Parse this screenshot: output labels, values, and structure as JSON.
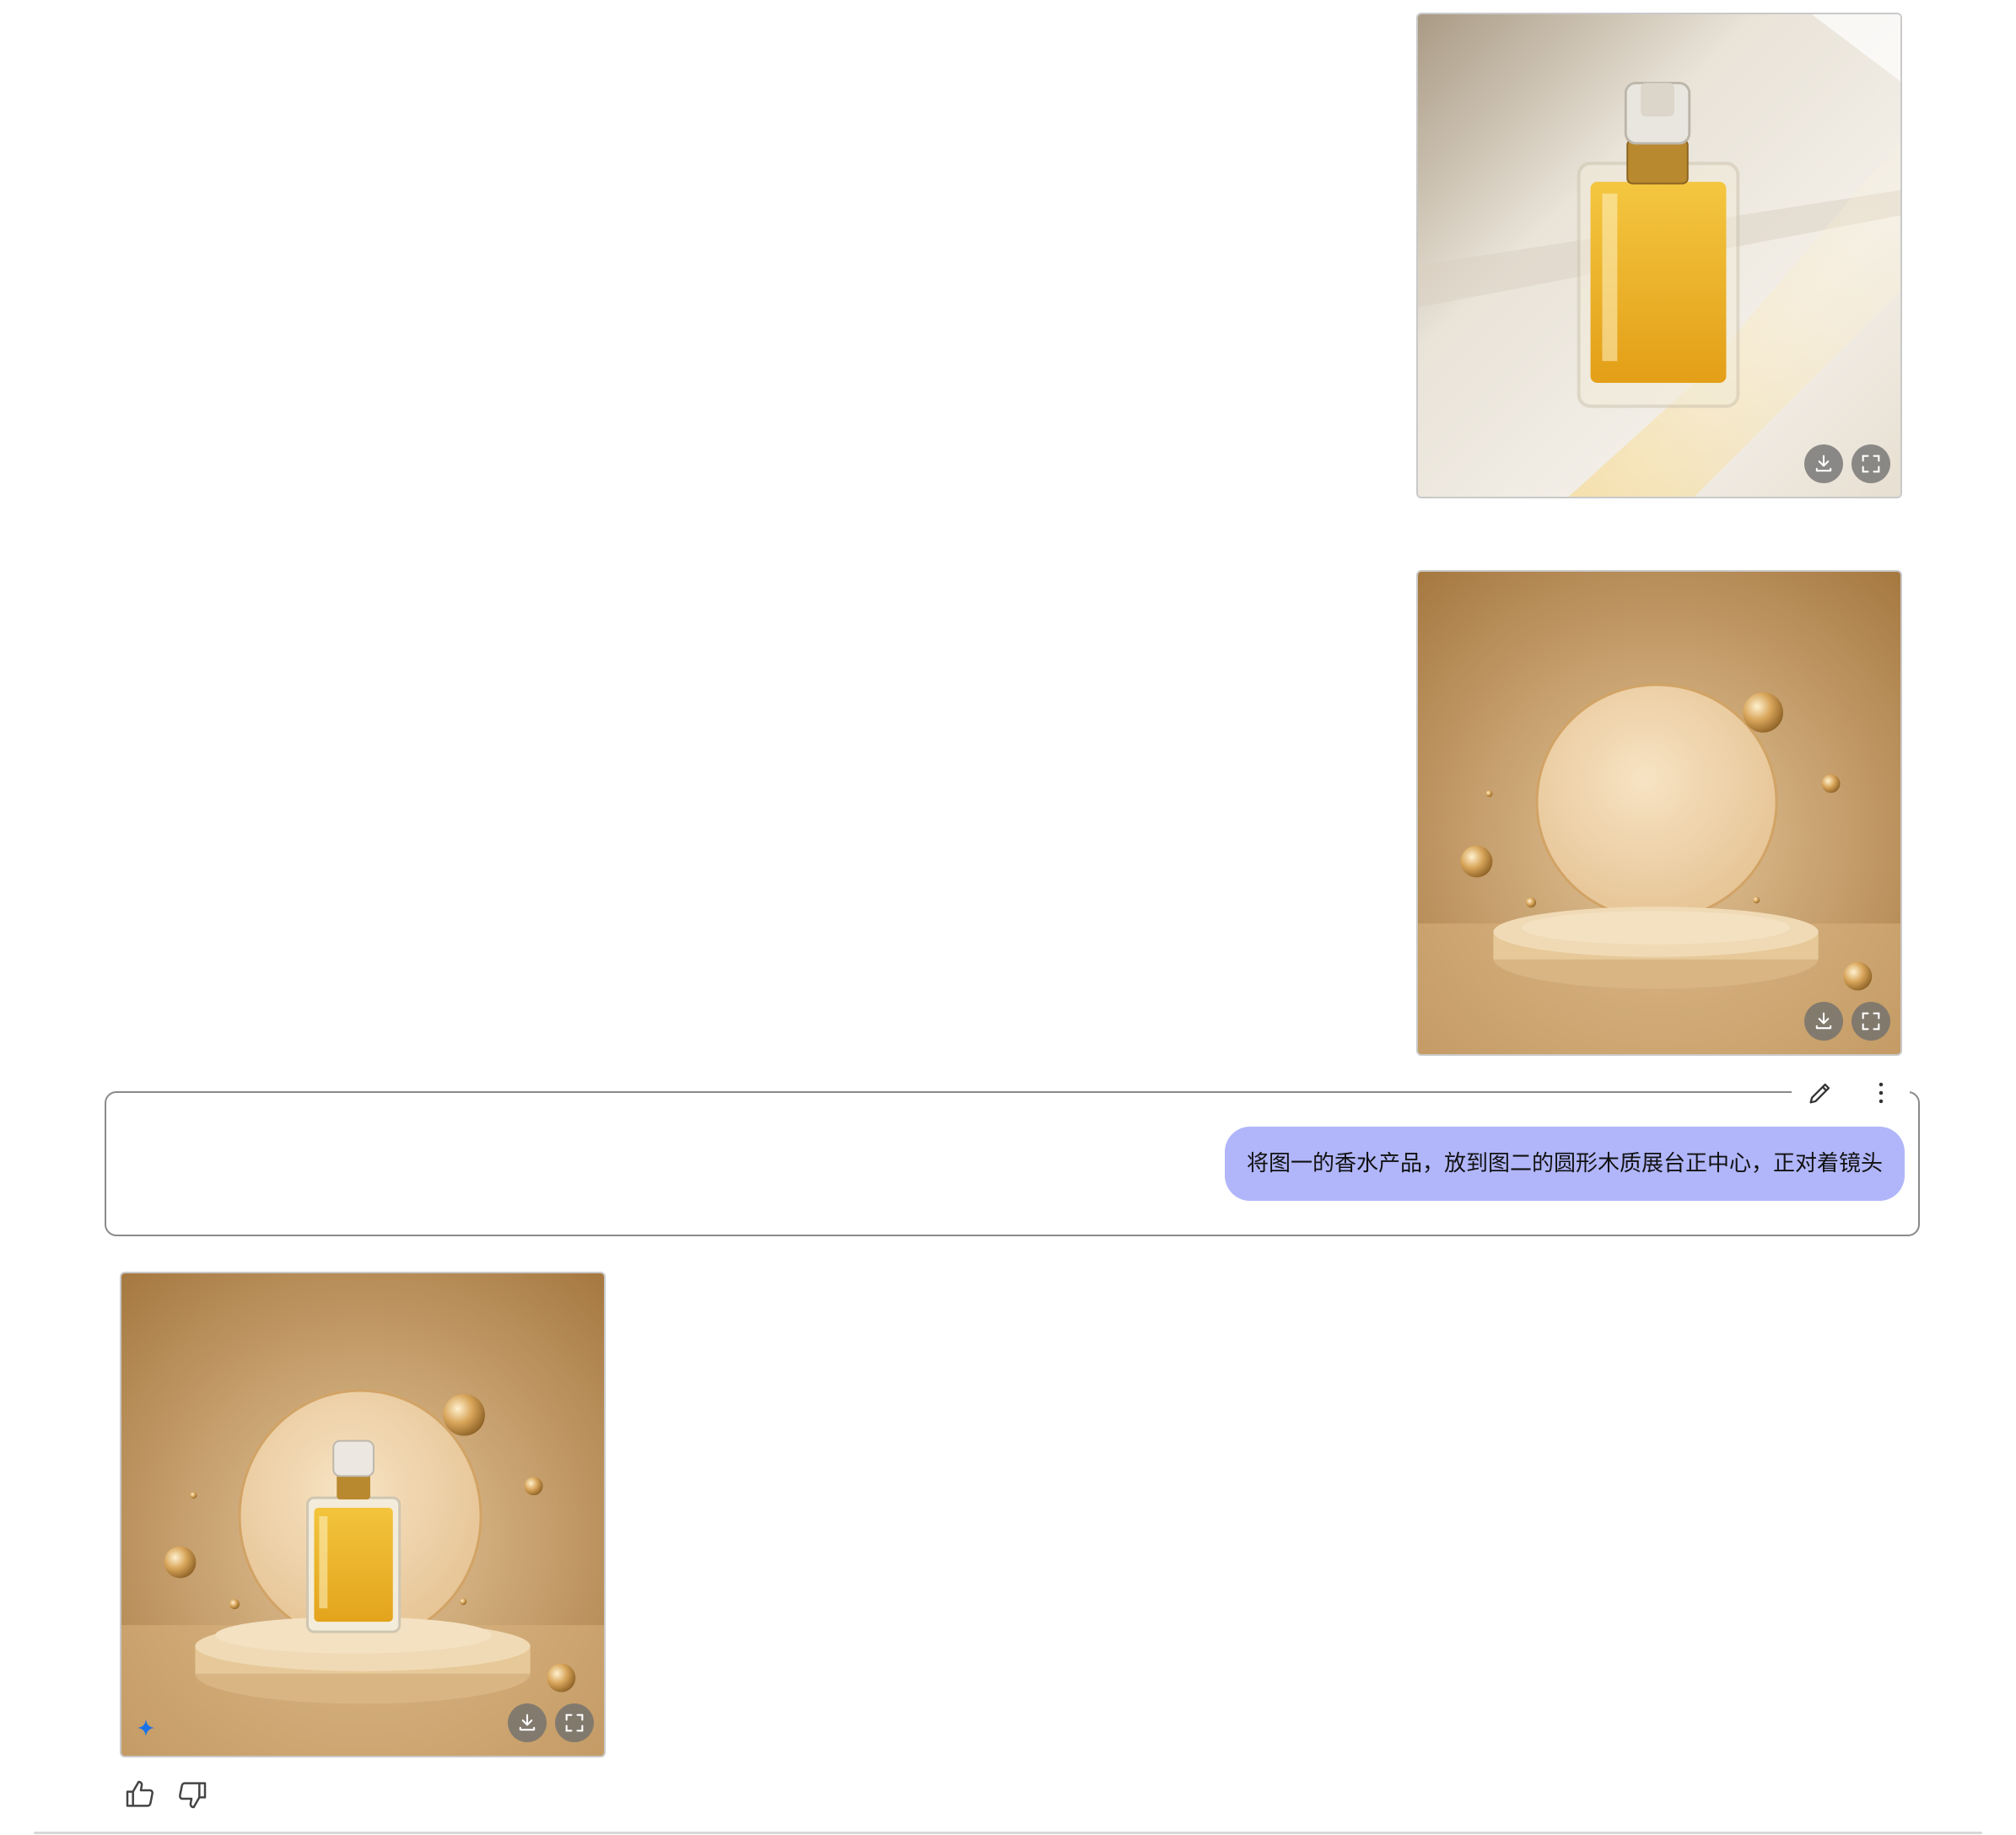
{
  "messages": {
    "reference_image_1": {
      "subject": "perfume bottle on tiled floor in sunlight",
      "actions": [
        "download-icon",
        "fullscreen-icon"
      ]
    },
    "reference_image_2": {
      "subject": "beige circular wooden display podium with gold spheres",
      "actions": [
        "download-icon",
        "fullscreen-icon"
      ]
    },
    "prompt": {
      "text": "将图一的香水产品，放到图二的圆形木质展台正中心，正对着镜头",
      "bubble_color": "#b1b6fa",
      "tools": [
        "edit-icon",
        "more-vertical-icon"
      ]
    },
    "generated_image": {
      "subject": "perfume bottle placed on circular podium",
      "badge_icon": "sparkle-icon",
      "actions": [
        "download-icon",
        "fullscreen-icon"
      ]
    },
    "feedback": {
      "icons": [
        "thumbs-up-icon",
        "thumbs-down-icon"
      ]
    }
  },
  "colors": {
    "accent": "#1a73e8",
    "border": "#8a8a8a"
  }
}
